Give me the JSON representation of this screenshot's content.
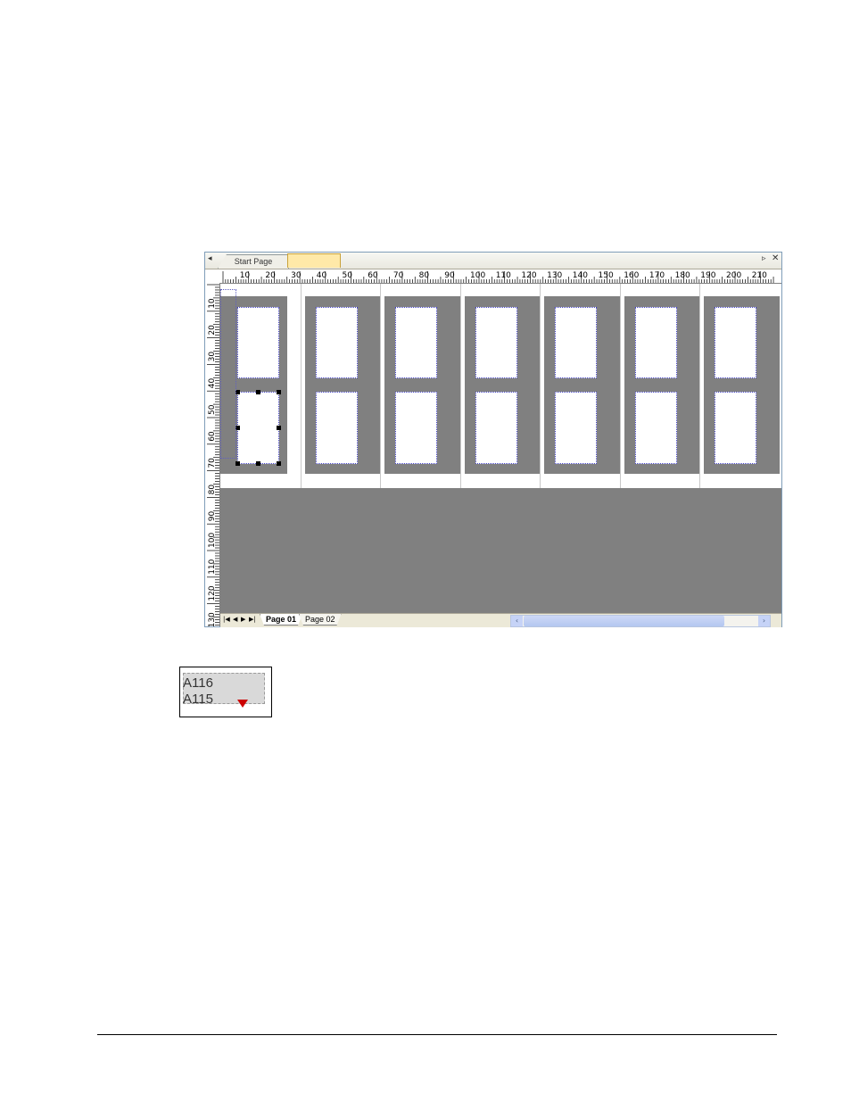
{
  "window": {
    "tabs": {
      "start_page": "Start Page",
      "active_tab": ""
    },
    "tab_strip": {
      "left_arrow_icon": "triangle-left-icon",
      "right_arrow_icon": "triangle-right-icon",
      "close_icon": "close-icon"
    },
    "horizontal_ruler_labels": [
      "10",
      "20",
      "30",
      "40",
      "50",
      "60",
      "70",
      "80",
      "90",
      "100",
      "110",
      "120",
      "130",
      "140",
      "150",
      "160",
      "170",
      "180",
      "190",
      "200",
      "210"
    ],
    "vertical_ruler_labels": [
      "10",
      "20",
      "30",
      "40",
      "50",
      "60",
      "70",
      "80",
      "90",
      "100",
      "110",
      "120",
      "130"
    ],
    "page_columns": 7,
    "labels_per_column": 2,
    "selected_label": {
      "column": 1,
      "row": 2
    },
    "bottom_bar": {
      "nav_icons": [
        "first-page-icon",
        "prev-page-icon",
        "next-page-icon",
        "last-page-icon"
      ],
      "page_tabs": [
        "Page 01",
        "Page 02"
      ],
      "active_page_tab": "Page 01"
    }
  },
  "field_figure": {
    "lines": [
      "A116",
      "A115"
    ],
    "marker_color": "#cc0000"
  },
  "colors": {
    "canvas_gray": "#808080",
    "active_tab": "#ffe9a8",
    "label_border": "#4040c0"
  }
}
